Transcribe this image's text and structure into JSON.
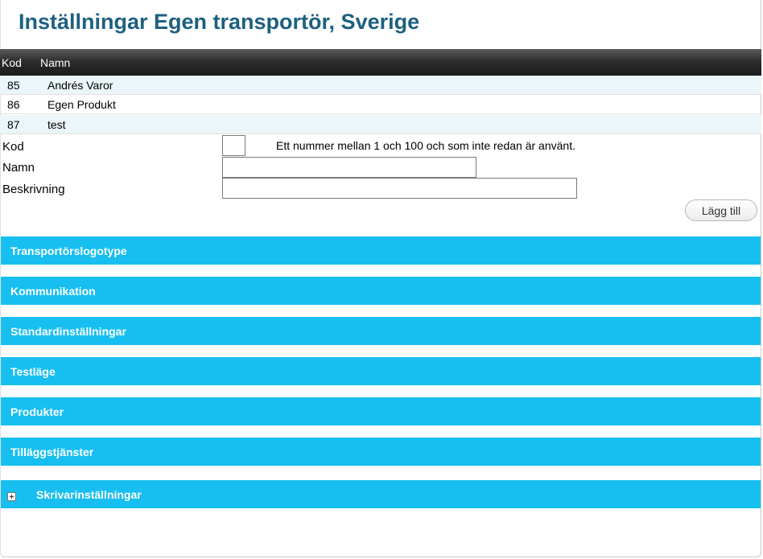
{
  "page": {
    "title": "Inställningar Egen transportör, Sverige"
  },
  "table": {
    "headers": {
      "code": "Kod",
      "name": "Namn"
    },
    "rows": [
      {
        "code": "85",
        "name": "Andrés Varor"
      },
      {
        "code": "86",
        "name": "Egen Produkt"
      },
      {
        "code": "87",
        "name": "test"
      }
    ]
  },
  "form": {
    "code_label": "Kod",
    "code_value": "",
    "code_hint": "Ett nummer mellan 1 och 100 och som inte redan är använt.",
    "name_label": "Namn",
    "name_value": "",
    "description_label": "Beskrivning",
    "description_value": "",
    "add_label": "Lägg till"
  },
  "sections": [
    {
      "title": "Transportörslogotype"
    },
    {
      "title": "Kommunikation"
    },
    {
      "title": "Standardinställningar"
    },
    {
      "title": "Testläge"
    },
    {
      "title": "Produkter"
    },
    {
      "title": "Tilläggstjänster"
    },
    {
      "title": "Skrivarinställningar",
      "icon": "plus-icon"
    }
  ],
  "colors": {
    "title": "#1d6080",
    "section_bar": "#17bff0",
    "row_alt": "#eaf6f9",
    "table_header": "#2e2e2e"
  }
}
